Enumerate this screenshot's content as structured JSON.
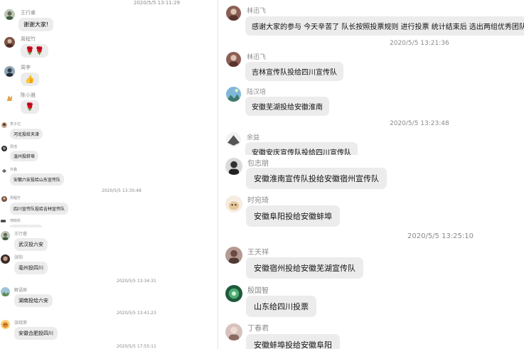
{
  "left_panel": {
    "messages": [
      {
        "name": "王行睿",
        "text": "谢谢大家!"
      },
      {
        "name": "周程竹",
        "text": "🌹🌹"
      },
      {
        "name": "周李",
        "text": "👍"
      },
      {
        "name": "陈小雅",
        "text": "🌹"
      },
      {
        "name": "李子亿",
        "text": "河北投给天津"
      },
      {
        "name": "周浩",
        "text": "温州投蚌埠"
      },
      {
        "name": "许鑫",
        "text": "安徽六安投给山东宣传队"
      },
      {
        "name": "周程竹",
        "text": "四川宣传队投给吉林宣传队"
      },
      {
        "name": "邢晓彤",
        "text": ""
      },
      {
        "name": "王行睿",
        "text": "武汉投六安"
      },
      {
        "name": "张阳",
        "text": "亳州投四川"
      },
      {
        "name": "解语辰",
        "text": "湖南投给六安"
      },
      {
        "name": "张晓荣",
        "text": "安徽合肥投四川"
      }
    ],
    "timestamps": [
      "2020/5/5 13:11:29",
      "2020/5/5 13:30:48",
      "2020/5/5 13:34:31",
      "2020/5/5 13:41:23",
      "2020/5/5 17:55:11"
    ]
  },
  "right_top": {
    "messages": [
      {
        "name": "林迅飞",
        "text": "感谢大家的参与 今天辛苦了 队长按照投票规则 进行投票 统计结束后 选出两组优秀团队"
      },
      {
        "name": "林迅飞",
        "text": "吉林宣传队投给四川宣传队"
      },
      {
        "name": "陆汉培",
        "text": "安徽芜湖投给安徽淮南"
      },
      {
        "name": "余益",
        "text": "安徽安庆宣传队投给四川宣传队"
      }
    ],
    "timestamps": [
      "2020/5/5 13:21:36",
      "2020/5/5 13:23:48"
    ]
  },
  "right_bottom": {
    "messages": [
      {
        "name": "包志朋",
        "text": "安徽淮南宣传队投给安徽宿州宣传队"
      },
      {
        "name": "时宛琦",
        "text": "安徽阜阳投给安徽蚌埠"
      },
      {
        "name": "王天祥",
        "text": "安徽宿州投给安徽芜湖宣传队"
      },
      {
        "name": "殷国智",
        "text": "山东给四川投票"
      },
      {
        "name": "丁春君",
        "text": "安徽蚌埠投给安徽阜阳"
      }
    ],
    "timestamps": [
      "2020/5/5 13:25:10"
    ]
  },
  "avatar_icons": [
    "portrait-avatar-icon",
    "landscape-avatar-icon",
    "cartoon-avatar-icon",
    "cat-avatar-icon"
  ]
}
